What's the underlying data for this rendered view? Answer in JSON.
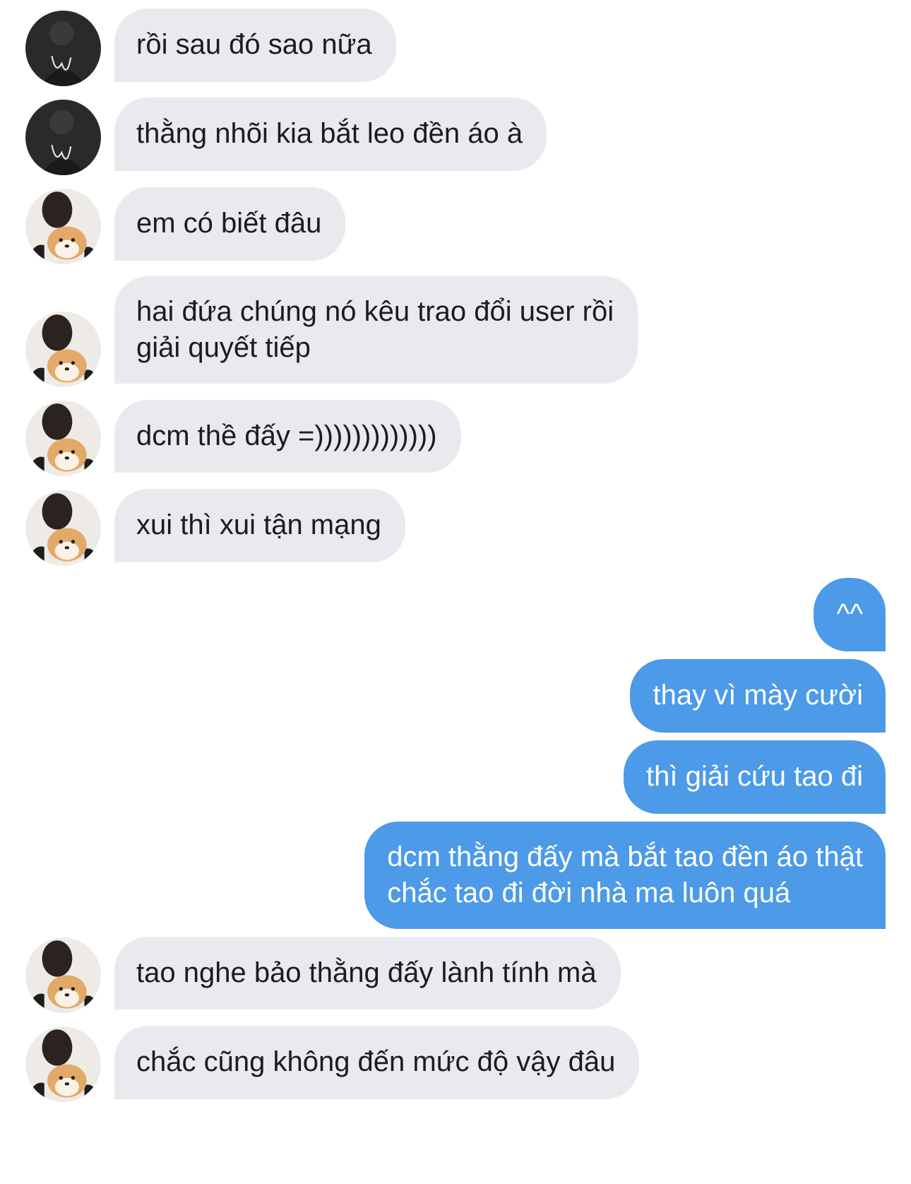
{
  "messages": [
    {
      "side": "in",
      "avatar": "avatar-dark",
      "text": "rồi sau đó sao nữa"
    },
    {
      "side": "in",
      "avatar": "avatar-dark",
      "text": "thằng nhõi kia bắt leo đền áo à"
    },
    {
      "side": "in",
      "avatar": "avatar-shiba",
      "text": "em có biết đâu"
    },
    {
      "side": "in",
      "avatar": "avatar-shiba",
      "text": "hai đứa chúng nó kêu trao đổi user rồi\ngiải quyết tiếp"
    },
    {
      "side": "in",
      "avatar": "avatar-shiba",
      "text": "dcm thề đấy =)))))))))))))"
    },
    {
      "side": "in",
      "avatar": "avatar-shiba",
      "text": "xui thì xui tận mạng"
    },
    {
      "side": "out",
      "text": "^^"
    },
    {
      "side": "out",
      "text": "thay vì mày cười"
    },
    {
      "side": "out",
      "text": "thì giải cứu tao đi"
    },
    {
      "side": "out",
      "text": "dcm thằng đấy mà bắt tao đền áo thật\nchắc tao đi đời nhà ma luôn quá"
    },
    {
      "side": "in",
      "avatar": "avatar-shiba",
      "text": "tao nghe bảo thằng đấy lành tính mà"
    },
    {
      "side": "in",
      "avatar": "avatar-shiba",
      "text": "chắc cũng không đến mức độ vậy đâu"
    }
  ],
  "colors": {
    "incoming_bubble": "#e9eaee",
    "outgoing_bubble": "#4c9ae8",
    "incoming_text": "#1c1c1e",
    "outgoing_text": "#ffffff"
  }
}
